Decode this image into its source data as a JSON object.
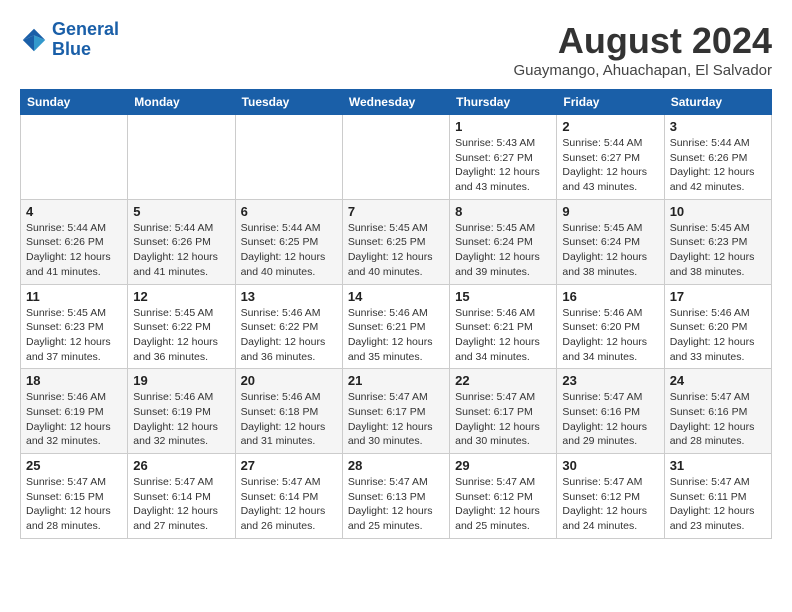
{
  "logo": {
    "line1": "General",
    "line2": "Blue"
  },
  "title": "August 2024",
  "location": "Guaymango, Ahuachapan, El Salvador",
  "days_of_week": [
    "Sunday",
    "Monday",
    "Tuesday",
    "Wednesday",
    "Thursday",
    "Friday",
    "Saturday"
  ],
  "weeks": [
    [
      {
        "day": "",
        "info": ""
      },
      {
        "day": "",
        "info": ""
      },
      {
        "day": "",
        "info": ""
      },
      {
        "day": "",
        "info": ""
      },
      {
        "day": "1",
        "info": "Sunrise: 5:43 AM\nSunset: 6:27 PM\nDaylight: 12 hours\nand 43 minutes."
      },
      {
        "day": "2",
        "info": "Sunrise: 5:44 AM\nSunset: 6:27 PM\nDaylight: 12 hours\nand 43 minutes."
      },
      {
        "day": "3",
        "info": "Sunrise: 5:44 AM\nSunset: 6:26 PM\nDaylight: 12 hours\nand 42 minutes."
      }
    ],
    [
      {
        "day": "4",
        "info": "Sunrise: 5:44 AM\nSunset: 6:26 PM\nDaylight: 12 hours\nand 41 minutes."
      },
      {
        "day": "5",
        "info": "Sunrise: 5:44 AM\nSunset: 6:26 PM\nDaylight: 12 hours\nand 41 minutes."
      },
      {
        "day": "6",
        "info": "Sunrise: 5:44 AM\nSunset: 6:25 PM\nDaylight: 12 hours\nand 40 minutes."
      },
      {
        "day": "7",
        "info": "Sunrise: 5:45 AM\nSunset: 6:25 PM\nDaylight: 12 hours\nand 40 minutes."
      },
      {
        "day": "8",
        "info": "Sunrise: 5:45 AM\nSunset: 6:24 PM\nDaylight: 12 hours\nand 39 minutes."
      },
      {
        "day": "9",
        "info": "Sunrise: 5:45 AM\nSunset: 6:24 PM\nDaylight: 12 hours\nand 38 minutes."
      },
      {
        "day": "10",
        "info": "Sunrise: 5:45 AM\nSunset: 6:23 PM\nDaylight: 12 hours\nand 38 minutes."
      }
    ],
    [
      {
        "day": "11",
        "info": "Sunrise: 5:45 AM\nSunset: 6:23 PM\nDaylight: 12 hours\nand 37 minutes."
      },
      {
        "day": "12",
        "info": "Sunrise: 5:45 AM\nSunset: 6:22 PM\nDaylight: 12 hours\nand 36 minutes."
      },
      {
        "day": "13",
        "info": "Sunrise: 5:46 AM\nSunset: 6:22 PM\nDaylight: 12 hours\nand 36 minutes."
      },
      {
        "day": "14",
        "info": "Sunrise: 5:46 AM\nSunset: 6:21 PM\nDaylight: 12 hours\nand 35 minutes."
      },
      {
        "day": "15",
        "info": "Sunrise: 5:46 AM\nSunset: 6:21 PM\nDaylight: 12 hours\nand 34 minutes."
      },
      {
        "day": "16",
        "info": "Sunrise: 5:46 AM\nSunset: 6:20 PM\nDaylight: 12 hours\nand 34 minutes."
      },
      {
        "day": "17",
        "info": "Sunrise: 5:46 AM\nSunset: 6:20 PM\nDaylight: 12 hours\nand 33 minutes."
      }
    ],
    [
      {
        "day": "18",
        "info": "Sunrise: 5:46 AM\nSunset: 6:19 PM\nDaylight: 12 hours\nand 32 minutes."
      },
      {
        "day": "19",
        "info": "Sunrise: 5:46 AM\nSunset: 6:19 PM\nDaylight: 12 hours\nand 32 minutes."
      },
      {
        "day": "20",
        "info": "Sunrise: 5:46 AM\nSunset: 6:18 PM\nDaylight: 12 hours\nand 31 minutes."
      },
      {
        "day": "21",
        "info": "Sunrise: 5:47 AM\nSunset: 6:17 PM\nDaylight: 12 hours\nand 30 minutes."
      },
      {
        "day": "22",
        "info": "Sunrise: 5:47 AM\nSunset: 6:17 PM\nDaylight: 12 hours\nand 30 minutes."
      },
      {
        "day": "23",
        "info": "Sunrise: 5:47 AM\nSunset: 6:16 PM\nDaylight: 12 hours\nand 29 minutes."
      },
      {
        "day": "24",
        "info": "Sunrise: 5:47 AM\nSunset: 6:16 PM\nDaylight: 12 hours\nand 28 minutes."
      }
    ],
    [
      {
        "day": "25",
        "info": "Sunrise: 5:47 AM\nSunset: 6:15 PM\nDaylight: 12 hours\nand 28 minutes."
      },
      {
        "day": "26",
        "info": "Sunrise: 5:47 AM\nSunset: 6:14 PM\nDaylight: 12 hours\nand 27 minutes."
      },
      {
        "day": "27",
        "info": "Sunrise: 5:47 AM\nSunset: 6:14 PM\nDaylight: 12 hours\nand 26 minutes."
      },
      {
        "day": "28",
        "info": "Sunrise: 5:47 AM\nSunset: 6:13 PM\nDaylight: 12 hours\nand 25 minutes."
      },
      {
        "day": "29",
        "info": "Sunrise: 5:47 AM\nSunset: 6:12 PM\nDaylight: 12 hours\nand 25 minutes."
      },
      {
        "day": "30",
        "info": "Sunrise: 5:47 AM\nSunset: 6:12 PM\nDaylight: 12 hours\nand 24 minutes."
      },
      {
        "day": "31",
        "info": "Sunrise: 5:47 AM\nSunset: 6:11 PM\nDaylight: 12 hours\nand 23 minutes."
      }
    ]
  ]
}
